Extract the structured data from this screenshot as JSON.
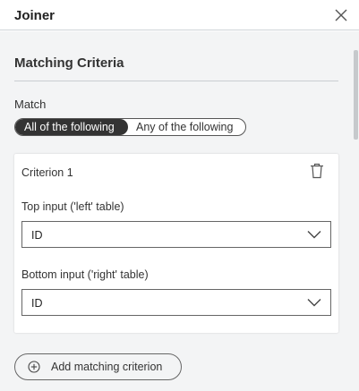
{
  "panel": {
    "title": "Joiner",
    "close_icon": "close-icon"
  },
  "section": {
    "title": "Matching Criteria"
  },
  "match": {
    "label": "Match",
    "options": [
      "All of the following",
      "Any of the following"
    ],
    "selected": "All of the following"
  },
  "criterion": {
    "title": "Criterion 1",
    "delete_icon": "trash-icon",
    "top_input": {
      "label": "Top input ('left' table)",
      "value": "ID"
    },
    "bottom_input": {
      "label": "Bottom input ('right' table)",
      "value": "ID"
    }
  },
  "add_button": {
    "label": "Add matching criterion",
    "icon": "plus-circle-icon"
  },
  "colors": {
    "accent_dark": "#333333",
    "panel_background": "#f3f4f5",
    "card_background": "#ffffff"
  }
}
